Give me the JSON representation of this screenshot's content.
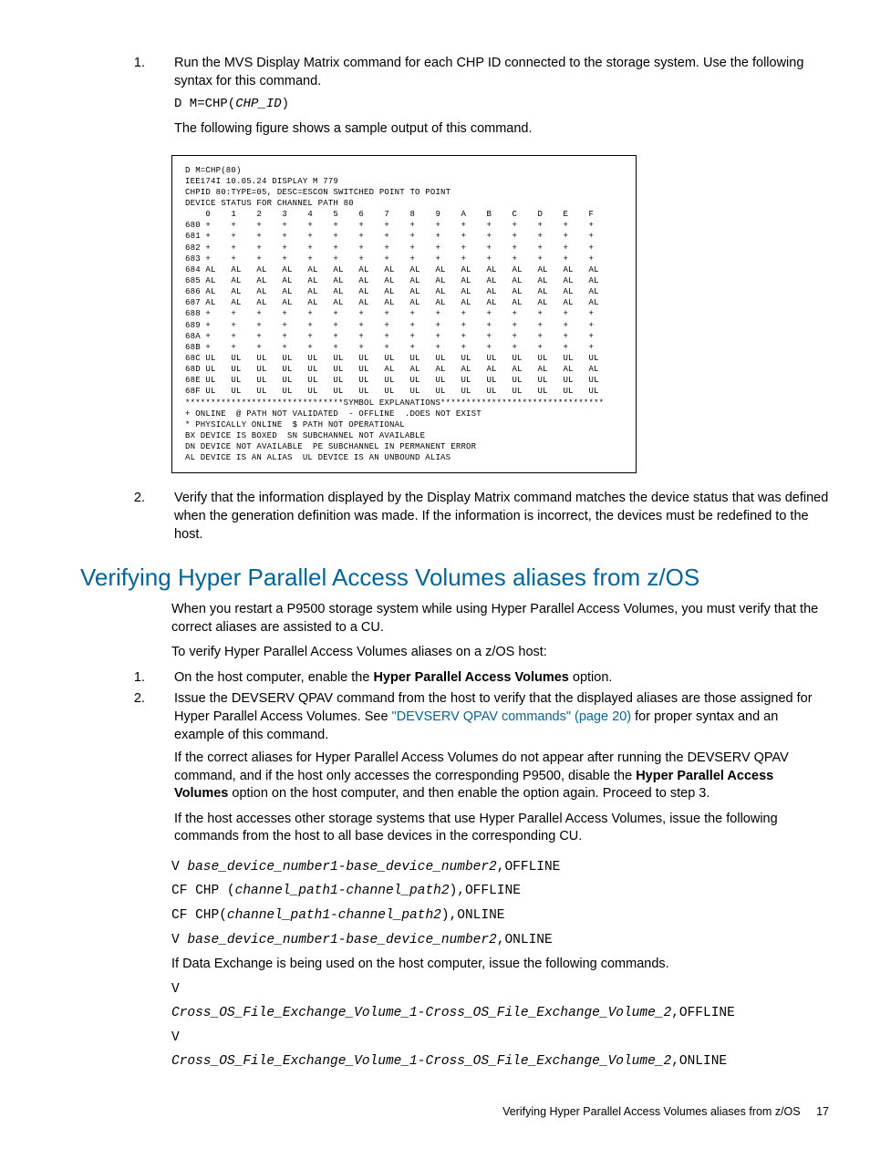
{
  "step1": {
    "text": "Run the MVS Display Matrix command for each CHP ID connected to the storage system. Use the following syntax for this command.",
    "cmd_prefix": "D M=CHP(",
    "cmd_var": "CHP_ID",
    "cmd_suffix": ")",
    "after": "The following figure shows a sample output of this command."
  },
  "chart_data": {
    "type": "table",
    "title_lines": [
      "D M=CHP(80)",
      "IEE174I 10.05.24 DISPLAY M 779",
      "CHPID 80:TYPE=05, DESC=ESCON SWITCHED POINT TO POINT",
      "DEVICE STATUS FOR CHANNEL PATH 80"
    ],
    "columns": [
      "0",
      "1",
      "2",
      "3",
      "4",
      "5",
      "6",
      "7",
      "8",
      "9",
      "A",
      "B",
      "C",
      "D",
      "E",
      "F"
    ],
    "rows": [
      {
        "id": "680",
        "v": [
          "+",
          "+",
          "+",
          "+",
          "+",
          "+",
          "+",
          "+",
          "+",
          "+",
          "+",
          "+",
          "+",
          "+",
          "+",
          "+"
        ]
      },
      {
        "id": "681",
        "v": [
          "+",
          "+",
          "+",
          "+",
          "+",
          "+",
          "+",
          "+",
          "+",
          "+",
          "+",
          "+",
          "+",
          "+",
          "+",
          "+"
        ]
      },
      {
        "id": "682",
        "v": [
          "+",
          "+",
          "+",
          "+",
          "+",
          "+",
          "+",
          "+",
          "+",
          "+",
          "+",
          "+",
          "+",
          "+",
          "+",
          "+"
        ]
      },
      {
        "id": "683",
        "v": [
          "+",
          "+",
          "+",
          "+",
          "+",
          "+",
          "+",
          "+",
          "+",
          "+",
          "+",
          "+",
          "+",
          "+",
          "+",
          "+"
        ]
      },
      {
        "id": "684",
        "v": [
          "AL",
          "AL",
          "AL",
          "AL",
          "AL",
          "AL",
          "AL",
          "AL",
          "AL",
          "AL",
          "AL",
          "AL",
          "AL",
          "AL",
          "AL",
          "AL"
        ]
      },
      {
        "id": "685",
        "v": [
          "AL",
          "AL",
          "AL",
          "AL",
          "AL",
          "AL",
          "AL",
          "AL",
          "AL",
          "AL",
          "AL",
          "AL",
          "AL",
          "AL",
          "AL",
          "AL"
        ]
      },
      {
        "id": "686",
        "v": [
          "AL",
          "AL",
          "AL",
          "AL",
          "AL",
          "AL",
          "AL",
          "AL",
          "AL",
          "AL",
          "AL",
          "AL",
          "AL",
          "AL",
          "AL",
          "AL"
        ]
      },
      {
        "id": "687",
        "v": [
          "AL",
          "AL",
          "AL",
          "AL",
          "AL",
          "AL",
          "AL",
          "AL",
          "AL",
          "AL",
          "AL",
          "AL",
          "AL",
          "AL",
          "AL",
          "AL"
        ]
      },
      {
        "id": "688",
        "v": [
          "+",
          "+",
          "+",
          "+",
          "+",
          "+",
          "+",
          "+",
          "+",
          "+",
          "+",
          "+",
          "+",
          "+",
          "+",
          "+"
        ]
      },
      {
        "id": "689",
        "v": [
          "+",
          "+",
          "+",
          "+",
          "+",
          "+",
          "+",
          "+",
          "+",
          "+",
          "+",
          "+",
          "+",
          "+",
          "+",
          "+"
        ]
      },
      {
        "id": "68A",
        "v": [
          "+",
          "+",
          "+",
          "+",
          "+",
          "+",
          "+",
          "+",
          "+",
          "+",
          "+",
          "+",
          "+",
          "+",
          "+",
          "+"
        ]
      },
      {
        "id": "68B",
        "v": [
          "+",
          "+",
          "+",
          "+",
          "+",
          "+",
          "+",
          "+",
          "+",
          "+",
          "+",
          "+",
          "+",
          "+",
          "+",
          "+"
        ]
      },
      {
        "id": "68C",
        "v": [
          "UL",
          "UL",
          "UL",
          "UL",
          "UL",
          "UL",
          "UL",
          "UL",
          "UL",
          "UL",
          "UL",
          "UL",
          "UL",
          "UL",
          "UL",
          "UL"
        ]
      },
      {
        "id": "68D",
        "v": [
          "UL",
          "UL",
          "UL",
          "UL",
          "UL",
          "UL",
          "UL",
          "AL",
          "AL",
          "AL",
          "AL",
          "AL",
          "AL",
          "AL",
          "AL",
          "AL"
        ]
      },
      {
        "id": "68E",
        "v": [
          "UL",
          "UL",
          "UL",
          "UL",
          "UL",
          "UL",
          "UL",
          "UL",
          "UL",
          "UL",
          "UL",
          "UL",
          "UL",
          "UL",
          "UL",
          "UL"
        ]
      },
      {
        "id": "68F",
        "v": [
          "UL",
          "UL",
          "UL",
          "UL",
          "UL",
          "UL",
          "UL",
          "UL",
          "UL",
          "UL",
          "UL",
          "UL",
          "UL",
          "UL",
          "UL",
          "UL"
        ]
      }
    ],
    "legend": [
      "*******************************SYMBOL EXPLANATIONS********************************",
      "+ ONLINE  @ PATH NOT VALIDATED  - OFFLINE  .DOES NOT EXIST",
      "* PHYSICALLY ONLINE  $ PATH NOT OPERATIONAL",
      "BX DEVICE IS BOXED  SN SUBCHANNEL NOT AVAILABLE",
      "DN DEVICE NOT AVAILABLE  PE SUBCHANNEL IN PERMANENT ERROR",
      "AL DEVICE IS AN ALIAS  UL DEVICE IS AN UNBOUND ALIAS"
    ]
  },
  "step2": "Verify that the information displayed by the Display Matrix command matches the device status that was defined when the generation definition was made. If the information is incorrect, the devices must be redefined to the host.",
  "section_heading": "Verifying Hyper Parallel Access Volumes aliases from z/OS",
  "intro1": "When you restart a P9500 storage system while using Hyper Parallel Access Volumes, you must verify that the correct aliases are assisted to a CU.",
  "intro2": "To verify Hyper Parallel Access Volumes aliases on a z/OS host:",
  "s1_a": "On the host computer, enable the ",
  "s1_b": "Hyper Parallel Access Volumes",
  "s1_c": " option.",
  "s2_a": "Issue the DEVSERV QPAV command from the host to verify that the displayed aliases are those assigned for Hyper Parallel Access Volumes. See ",
  "s2_link": "\"DEVSERV QPAV commands\" (page 20)",
  "s2_b": " for proper syntax and an example of this command.",
  "s2_p2a": "If the correct aliases for Hyper Parallel Access Volumes do not appear after running the DEVSERV QPAV command, and if the host only accesses the corresponding P9500, disable the ",
  "s2_p2b": "Hyper Parallel Access Volumes",
  "s2_p2c": " option on the host computer, and then enable the option again. Proceed to step 3.",
  "s2_p3": "If the host accesses other storage systems that use Hyper Parallel Access Volumes, issue the following commands from the host to all base devices in the corresponding CU.",
  "cmds": {
    "c1_a": "V ",
    "c1_b": "base_device_number1-base_device_number2",
    "c1_c": ",OFFLINE",
    "c2_a": "CF CHP (",
    "c2_b": "channel_path1-channel_path2",
    "c2_c": "),OFFLINE",
    "c3_a": "CF CHP(",
    "c3_b": "channel_path1-channel_path2",
    "c3_c": "),ONLINE",
    "c4_a": "V ",
    "c4_b": "base_device_number1-base_device_number2",
    "c4_c": ",ONLINE"
  },
  "dx_intro": "If Data Exchange is being used on the host computer, issue the following commands.",
  "dx": {
    "v": "V",
    "l1_a": "Cross_OS_File_Exchange_Volume_1-Cross_OS_File_Exchange_Volume_2",
    "l1_b": ",OFFLINE",
    "l2_a": "Cross_OS_File_Exchange_Volume_1-Cross_OS_File_Exchange_Volume_2",
    "l2_b": ",ONLINE"
  },
  "footer_text": "Verifying Hyper Parallel Access Volumes aliases from z/OS",
  "page_num": "17"
}
